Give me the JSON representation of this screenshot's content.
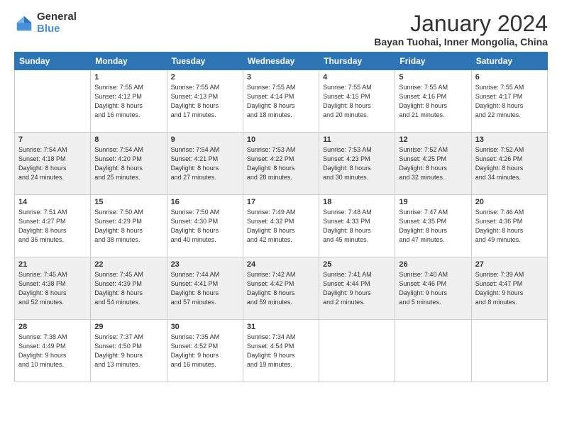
{
  "logo": {
    "general": "General",
    "blue": "Blue"
  },
  "header": {
    "title": "January 2024",
    "subtitle": "Bayan Tuohai, Inner Mongolia, China"
  },
  "days_of_week": [
    "Sunday",
    "Monday",
    "Tuesday",
    "Wednesday",
    "Thursday",
    "Friday",
    "Saturday"
  ],
  "weeks": [
    [
      {
        "day": "",
        "info": ""
      },
      {
        "day": "1",
        "info": "Sunrise: 7:55 AM\nSunset: 4:12 PM\nDaylight: 8 hours\nand 16 minutes."
      },
      {
        "day": "2",
        "info": "Sunrise: 7:55 AM\nSunset: 4:13 PM\nDaylight: 8 hours\nand 17 minutes."
      },
      {
        "day": "3",
        "info": "Sunrise: 7:55 AM\nSunset: 4:14 PM\nDaylight: 8 hours\nand 18 minutes."
      },
      {
        "day": "4",
        "info": "Sunrise: 7:55 AM\nSunset: 4:15 PM\nDaylight: 8 hours\nand 20 minutes."
      },
      {
        "day": "5",
        "info": "Sunrise: 7:55 AM\nSunset: 4:16 PM\nDaylight: 8 hours\nand 21 minutes."
      },
      {
        "day": "6",
        "info": "Sunrise: 7:55 AM\nSunset: 4:17 PM\nDaylight: 8 hours\nand 22 minutes."
      }
    ],
    [
      {
        "day": "7",
        "info": "Sunrise: 7:54 AM\nSunset: 4:18 PM\nDaylight: 8 hours\nand 24 minutes."
      },
      {
        "day": "8",
        "info": "Sunrise: 7:54 AM\nSunset: 4:20 PM\nDaylight: 8 hours\nand 25 minutes."
      },
      {
        "day": "9",
        "info": "Sunrise: 7:54 AM\nSunset: 4:21 PM\nDaylight: 8 hours\nand 27 minutes."
      },
      {
        "day": "10",
        "info": "Sunrise: 7:53 AM\nSunset: 4:22 PM\nDaylight: 8 hours\nand 28 minutes."
      },
      {
        "day": "11",
        "info": "Sunrise: 7:53 AM\nSunset: 4:23 PM\nDaylight: 8 hours\nand 30 minutes."
      },
      {
        "day": "12",
        "info": "Sunrise: 7:52 AM\nSunset: 4:25 PM\nDaylight: 8 hours\nand 32 minutes."
      },
      {
        "day": "13",
        "info": "Sunrise: 7:52 AM\nSunset: 4:26 PM\nDaylight: 8 hours\nand 34 minutes."
      }
    ],
    [
      {
        "day": "14",
        "info": "Sunrise: 7:51 AM\nSunset: 4:27 PM\nDaylight: 8 hours\nand 36 minutes."
      },
      {
        "day": "15",
        "info": "Sunrise: 7:50 AM\nSunset: 4:29 PM\nDaylight: 8 hours\nand 38 minutes."
      },
      {
        "day": "16",
        "info": "Sunrise: 7:50 AM\nSunset: 4:30 PM\nDaylight: 8 hours\nand 40 minutes."
      },
      {
        "day": "17",
        "info": "Sunrise: 7:49 AM\nSunset: 4:32 PM\nDaylight: 8 hours\nand 42 minutes."
      },
      {
        "day": "18",
        "info": "Sunrise: 7:48 AM\nSunset: 4:33 PM\nDaylight: 8 hours\nand 45 minutes."
      },
      {
        "day": "19",
        "info": "Sunrise: 7:47 AM\nSunset: 4:35 PM\nDaylight: 8 hours\nand 47 minutes."
      },
      {
        "day": "20",
        "info": "Sunrise: 7:46 AM\nSunset: 4:36 PM\nDaylight: 8 hours\nand 49 minutes."
      }
    ],
    [
      {
        "day": "21",
        "info": "Sunrise: 7:45 AM\nSunset: 4:38 PM\nDaylight: 8 hours\nand 52 minutes."
      },
      {
        "day": "22",
        "info": "Sunrise: 7:45 AM\nSunset: 4:39 PM\nDaylight: 8 hours\nand 54 minutes."
      },
      {
        "day": "23",
        "info": "Sunrise: 7:44 AM\nSunset: 4:41 PM\nDaylight: 8 hours\nand 57 minutes."
      },
      {
        "day": "24",
        "info": "Sunrise: 7:42 AM\nSunset: 4:42 PM\nDaylight: 8 hours\nand 59 minutes."
      },
      {
        "day": "25",
        "info": "Sunrise: 7:41 AM\nSunset: 4:44 PM\nDaylight: 9 hours\nand 2 minutes."
      },
      {
        "day": "26",
        "info": "Sunrise: 7:40 AM\nSunset: 4:46 PM\nDaylight: 9 hours\nand 5 minutes."
      },
      {
        "day": "27",
        "info": "Sunrise: 7:39 AM\nSunset: 4:47 PM\nDaylight: 9 hours\nand 8 minutes."
      }
    ],
    [
      {
        "day": "28",
        "info": "Sunrise: 7:38 AM\nSunset: 4:49 PM\nDaylight: 9 hours\nand 10 minutes."
      },
      {
        "day": "29",
        "info": "Sunrise: 7:37 AM\nSunset: 4:50 PM\nDaylight: 9 hours\nand 13 minutes."
      },
      {
        "day": "30",
        "info": "Sunrise: 7:35 AM\nSunset: 4:52 PM\nDaylight: 9 hours\nand 16 minutes."
      },
      {
        "day": "31",
        "info": "Sunrise: 7:34 AM\nSunset: 4:54 PM\nDaylight: 9 hours\nand 19 minutes."
      },
      {
        "day": "",
        "info": ""
      },
      {
        "day": "",
        "info": ""
      },
      {
        "day": "",
        "info": ""
      }
    ]
  ]
}
